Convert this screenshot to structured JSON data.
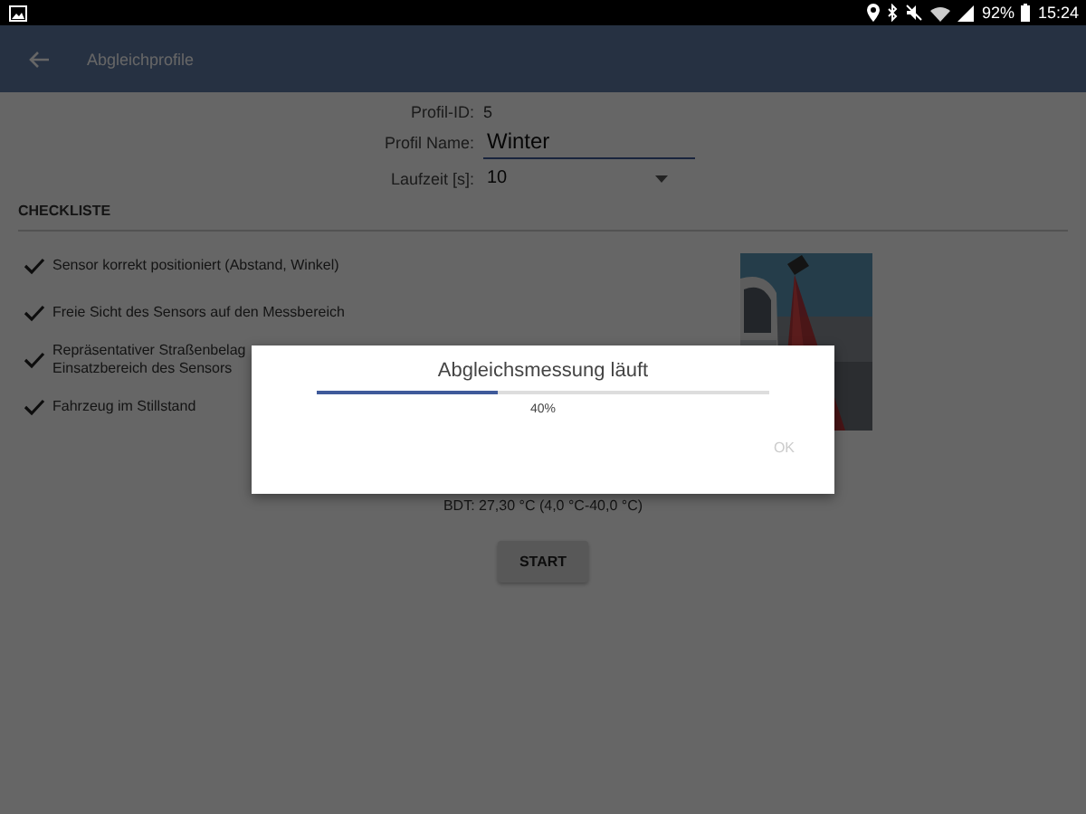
{
  "status_bar": {
    "battery": "92%",
    "time": "15:24"
  },
  "app_bar": {
    "title": "Abgleichprofile"
  },
  "profile": {
    "id_label": "Profil-ID:",
    "id_value": "5",
    "name_label": "Profil Name:",
    "name_value": "Winter",
    "runtime_label": "Laufzeit [s]:",
    "runtime_value": "10"
  },
  "checklist": {
    "title": "CHECKLISTE",
    "items": [
      {
        "lines": [
          "Sensor korrekt positioniert (Abstand, Winkel)"
        ],
        "checked": true
      },
      {
        "lines": [
          "Freie Sicht des Sensors auf den Messbereich"
        ],
        "checked": true
      },
      {
        "lines": [
          "Repräsentativer Straßenbelag",
          "Einsatzbereich des Sensors"
        ],
        "checked": true
      },
      {
        "lines": [
          "Fahrzeug im Stillstand"
        ],
        "checked": true
      }
    ]
  },
  "temperature": "BDT: 27,30 °C (4,0 °C-40,0 °C)",
  "start_button": "START",
  "dialog": {
    "title": "Abgleichsmessung läuft",
    "level": 0.4,
    "percent": "40%",
    "ok_button": "OK",
    "ok_disabled": true
  }
}
